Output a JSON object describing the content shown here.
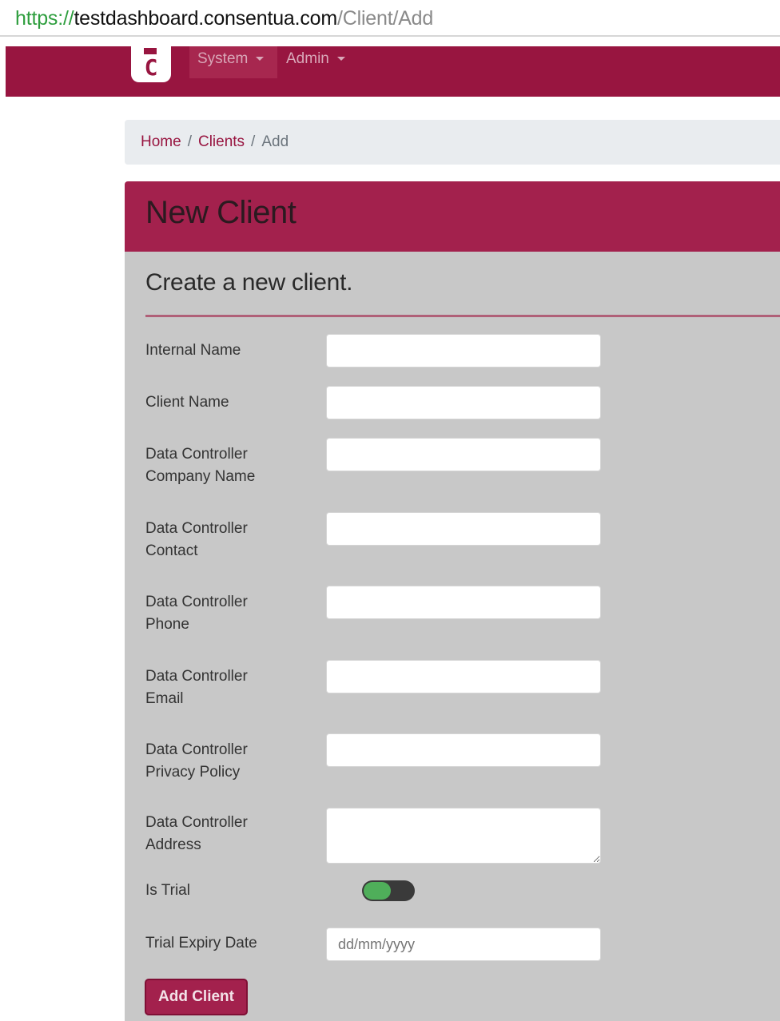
{
  "browser": {
    "url_scheme": "https://",
    "url_host": "testdashboard.consentua.com",
    "url_path": "/Client/Add"
  },
  "navbar": {
    "logo_letter": "C",
    "items": [
      {
        "label": "System"
      },
      {
        "label": "Admin"
      }
    ],
    "color": "#981540"
  },
  "breadcrumb": {
    "items": [
      "Home",
      "Clients",
      "Add"
    ],
    "separator": "/"
  },
  "card": {
    "title": "New Client",
    "subtitle": "Create a new client."
  },
  "form": {
    "fields": [
      {
        "label": "Internal Name",
        "value": ""
      },
      {
        "label": "Client Name",
        "value": ""
      },
      {
        "label": "Data Controller Company Name",
        "value": ""
      },
      {
        "label": "Data Controller Contact",
        "value": ""
      },
      {
        "label": "Data Controller Phone",
        "value": ""
      },
      {
        "label": "Data Controller Email",
        "value": ""
      },
      {
        "label": "Data Controller Privacy Policy",
        "value": ""
      },
      {
        "label": "Data Controller Address",
        "value": ""
      }
    ],
    "is_trial": {
      "label": "Is Trial",
      "checked": true
    },
    "trial_expiry": {
      "label": "Trial Expiry Date",
      "placeholder": "dd/mm/yyyy"
    },
    "submit_label": "Add Client"
  },
  "colors": {
    "brand": "#981540",
    "toggle_on": "#4fae5a"
  }
}
